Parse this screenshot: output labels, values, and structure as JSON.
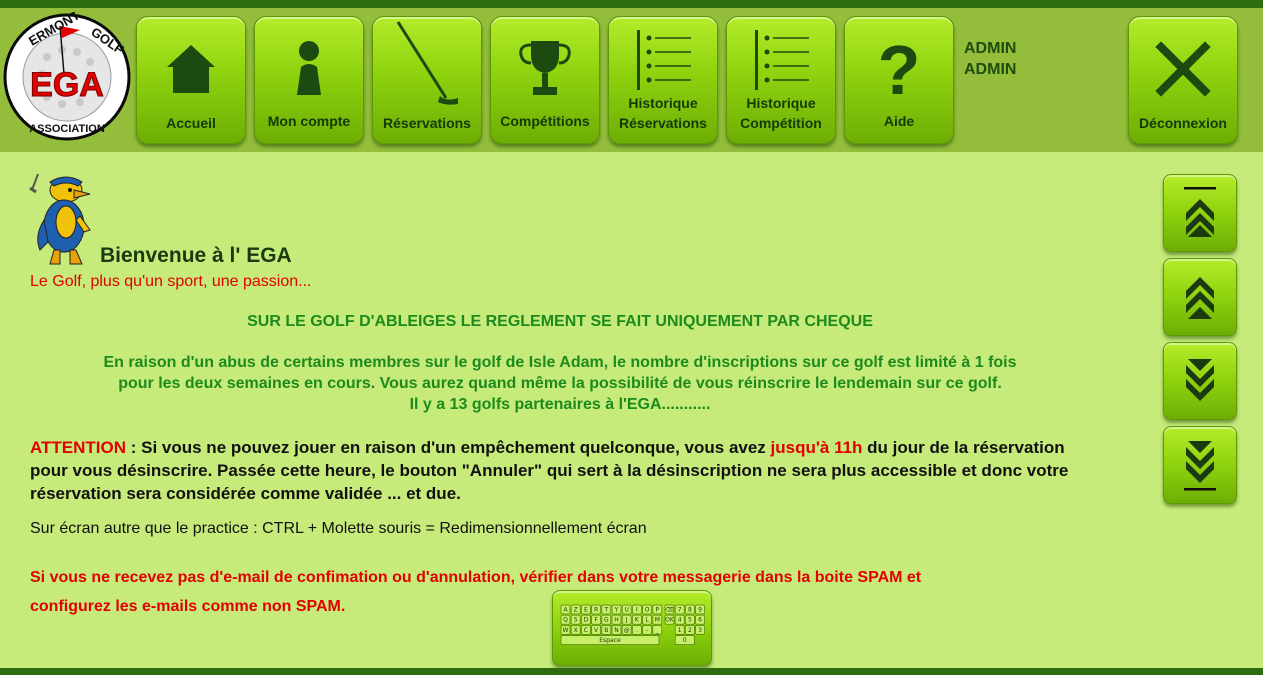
{
  "logo": {
    "top_text": "ERMONT",
    "top_text_right": "GOLF",
    "center_text": "EGA",
    "bottom_text": "ASSOCIATION"
  },
  "nav": {
    "items": [
      {
        "label": "Accueil",
        "icon": "home-icon"
      },
      {
        "label": "Mon compte",
        "icon": "user-icon"
      },
      {
        "label": "Réservations",
        "icon": "golf-club-icon"
      },
      {
        "label": "Compétitions",
        "icon": "trophy-icon"
      },
      {
        "label_line1": "Historique",
        "label_line2": "Réservations",
        "icon": "list-icon"
      },
      {
        "label_line1": "Historique",
        "label_line2": "Compétition",
        "icon": "list-icon"
      },
      {
        "label": "Aide",
        "icon": "question-icon"
      }
    ],
    "logout_label": "Déconnexion",
    "logout_icon": "close-icon"
  },
  "user": {
    "first_name": "ADMIN",
    "last_name": "ADMIN"
  },
  "side": {
    "buttons": [
      {
        "icon": "scroll-top-icon"
      },
      {
        "icon": "scroll-up-icon"
      },
      {
        "icon": "scroll-down-icon"
      },
      {
        "icon": "scroll-bottom-icon"
      }
    ]
  },
  "main": {
    "welcome": "Bienvenue à l' EGA",
    "tagline": "Le Golf, plus qu'un sport, une passion...",
    "cheque_notice": "SUR LE GOLF D'ABLEIGES LE REGLEMENT SE FAIT UNIQUEMENT PAR CHEQUE",
    "abus_line1": "En raison d'un abus de certains membres sur le golf de Isle Adam, le nombre d'inscriptions sur ce golf est limité à 1 fois",
    "abus_line2": "pour les deux semaines en cours. Vous aurez quand même la possibilité de vous réinscrire le lendemain sur ce golf.",
    "abus_line3": "Il y a 13 golfs partenaires à l'EGA...........",
    "attention_label": "ATTENTION",
    "attention_part1": " : Si vous ne pouvez jouer en raison d'un empêchement quelconque, vous avez ",
    "attention_deadline": "jusqu'à 11h",
    "attention_part2": " du jour de la réservation pour vous désinscrire. Passée cette heure, le bouton \"Annuler\" qui sert à la désinscription ne sera plus accessible et donc votre réservation sera considérée comme validée ... et due.",
    "ecran_tip": "Sur écran autre que le practice : CTRL + Molette souris = Redimensionnellement écran",
    "spam_line1": "Si vous ne recevez pas d'e-mail de confimation ou d'annulation, vérifier dans votre messagerie dans la boite SPAM et",
    "spam_line2": "configurez les e-mails comme non SPAM."
  },
  "keyboard": {
    "row1": [
      "A",
      "Z",
      "E",
      "R",
      "T",
      "Y",
      "U",
      "I",
      "O",
      "P",
      "⌫",
      "7",
      "8",
      "9"
    ],
    "row2": [
      "Q",
      "S",
      "D",
      "F",
      "G",
      "H",
      "J",
      "K",
      "L",
      "M",
      "OK",
      "4",
      "5",
      "6"
    ],
    "row3": [
      "W",
      "X",
      "C",
      "V",
      "B",
      "N",
      "@",
      ".",
      "-",
      "_",
      "1",
      "2",
      "3"
    ],
    "space_label": "Espace",
    "zero_label": "0"
  },
  "colors": {
    "header_bg": "#93bd3b",
    "page_bg": "#c6eb7a",
    "button_green": "#8fd20e",
    "dark_green": "#2f6b10",
    "alert_red": "#e30000",
    "notice_green": "#1d8a1d"
  }
}
